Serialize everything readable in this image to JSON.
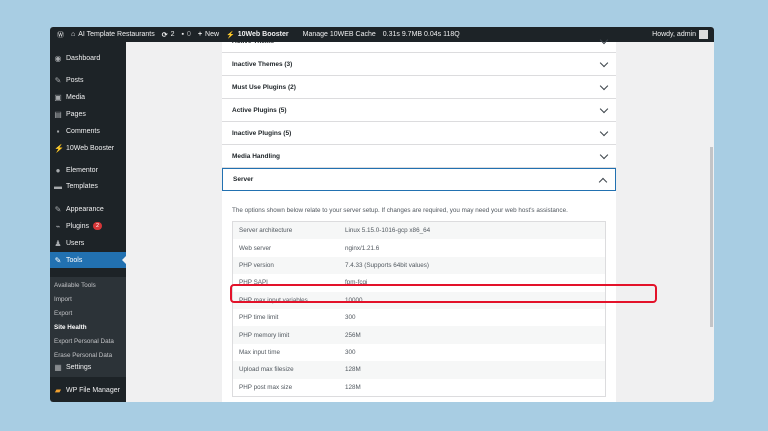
{
  "adminbar": {
    "site": "AI Template Restaurants",
    "updates": "2",
    "comments": "0",
    "new": "New",
    "booster": "10Web Booster",
    "cache": "Manage 10WEB Cache",
    "stats": "0.31s  9.7MB  0.04s  118Q",
    "howdy": "Howdy, admin"
  },
  "sidebar": {
    "items": [
      {
        "label": "Dashboard",
        "icon": "dashboard-icon"
      },
      {
        "label": "Posts",
        "icon": "pin-icon"
      },
      {
        "label": "Media",
        "icon": "media-icon"
      },
      {
        "label": "Pages",
        "icon": "pages-icon"
      },
      {
        "label": "Comments",
        "icon": "comment-icon"
      },
      {
        "label": "10Web Booster",
        "icon": "booster-icon"
      },
      {
        "label": "Elementor",
        "icon": "elementor-icon"
      },
      {
        "label": "Templates",
        "icon": "folder-icon"
      },
      {
        "label": "Appearance",
        "icon": "brush-icon"
      },
      {
        "label": "Plugins",
        "icon": "plugin-icon",
        "badge": "2"
      },
      {
        "label": "Users",
        "icon": "users-icon"
      },
      {
        "label": "Tools",
        "icon": "wrench-icon",
        "active": true
      },
      {
        "label": "Settings",
        "icon": "settings-icon"
      },
      {
        "label": "WP File Manager",
        "icon": "file-manager-icon"
      }
    ],
    "submenu": [
      "Available Tools",
      "Import",
      "Export",
      "Site Health",
      "Export Personal Data",
      "Erase Personal Data"
    ],
    "current_sub": "Site Health"
  },
  "accordions": [
    "Active Theme",
    "Inactive Themes (3)",
    "Must Use Plugins (2)",
    "Active Plugins (5)",
    "Inactive Plugins (5)",
    "Media Handling",
    "Server"
  ],
  "server": {
    "description": "The options shown below relate to your server setup. If changes are required, you may need your web host's assistance.",
    "rows": [
      [
        "Server architecture",
        "Linux 5.15.0-1016-gcp x86_64"
      ],
      [
        "Web server",
        "nginx/1.21.6"
      ],
      [
        "PHP version",
        "7.4.33 (Supports 64bit values)"
      ],
      [
        "PHP SAPI",
        "fpm-fcgi"
      ],
      [
        "PHP max input variables",
        "10000"
      ],
      [
        "PHP time limit",
        "300"
      ],
      [
        "PHP memory limit",
        "256M"
      ],
      [
        "Max input time",
        "300"
      ],
      [
        "Upload max filesize",
        "128M"
      ],
      [
        "PHP post max size",
        "128M"
      ]
    ],
    "highlighted_row": "PHP version"
  },
  "colors": {
    "accent": "#2271b1",
    "highlight": "#e3122a",
    "adminbar": "#1d2327"
  }
}
